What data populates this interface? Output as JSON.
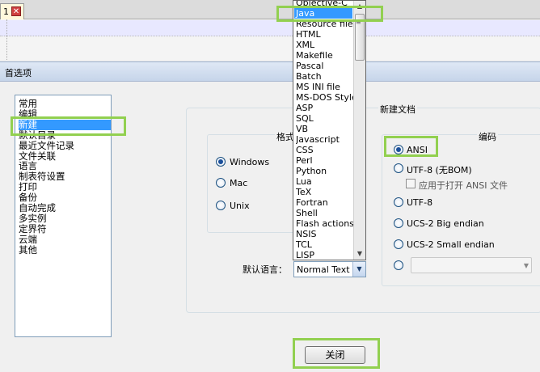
{
  "editor": {
    "tab_number": "1",
    "tab_close_glyph": "✕"
  },
  "dialog": {
    "title": "首选项"
  },
  "categories": [
    {
      "label": "常用"
    },
    {
      "label": "编辑"
    },
    {
      "label": "新建",
      "selected": true
    },
    {
      "label": "默认目录"
    },
    {
      "label": "最近文件记录"
    },
    {
      "label": "文件关联"
    },
    {
      "label": "语言"
    },
    {
      "label": "制表符设置"
    },
    {
      "label": "打印"
    },
    {
      "label": "备份"
    },
    {
      "label": "自动完成"
    },
    {
      "label": "多实例"
    },
    {
      "label": "定界符"
    },
    {
      "label": "云端"
    },
    {
      "label": "其他"
    }
  ],
  "new_document": {
    "group_label": "新建文档",
    "format_label": "格式",
    "formats": [
      {
        "label": "Windows",
        "checked": true
      },
      {
        "label": "Mac",
        "checked": false
      },
      {
        "label": "Unix",
        "checked": false
      }
    ],
    "encoding_label": "编码",
    "encodings": [
      {
        "label": "ANSI",
        "checked": true
      },
      {
        "label": "UTF-8 (无BOM)",
        "checked": false
      },
      {
        "label": "UTF-8",
        "checked": false
      },
      {
        "label": "UCS-2 Big endian",
        "checked": false
      },
      {
        "label": "UCS-2 Small endian",
        "checked": false
      }
    ],
    "apply_ansi_checkbox_label": "应用于打开 ANSI 文件",
    "default_language_label": "默认语言：",
    "default_language_value": "Normal Text"
  },
  "language_dropdown": {
    "items": [
      "Objective-C",
      "Java",
      "Resource file",
      "HTML",
      "XML",
      "Makefile",
      "Pascal",
      "Batch",
      "MS INI file",
      "MS-DOS Style",
      "ASP",
      "SQL",
      "VB",
      "Javascript",
      "CSS",
      "Perl",
      "Python",
      "Lua",
      "TeX",
      "Fortran",
      "Shell",
      "Flash actionscript",
      "NSIS",
      "TCL",
      "LISP"
    ],
    "selected": "Java"
  },
  "buttons": {
    "close_label": "关闭"
  },
  "colors": {
    "highlight": "#92d050",
    "selection": "#3399ff"
  }
}
